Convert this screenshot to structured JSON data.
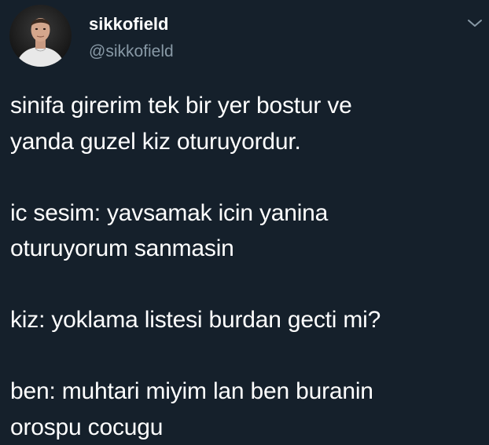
{
  "colors": {
    "background": "#15202b",
    "text_primary": "#ffffff",
    "text_secondary": "#8899a6"
  },
  "author": {
    "display_name": "sikkofield",
    "handle": "@sikkofield",
    "avatar_icon": "profile-photo"
  },
  "menu": {
    "icon": "chevron-down-icon"
  },
  "tweet": {
    "paragraphs": [
      {
        "lines": [
          "sinifa girerim tek bir yer bostur ve",
          "yanda guzel kiz oturuyordur."
        ]
      },
      {
        "lines": [
          "ic sesim: yavsamak icin yanina",
          "oturuyorum sanmasin"
        ]
      },
      {
        "lines": [
          "kiz: yoklama listesi burdan gecti mi?"
        ]
      },
      {
        "lines": [
          "ben: muhtari miyim lan ben buranin",
          "orospu cocugu"
        ]
      }
    ]
  }
}
